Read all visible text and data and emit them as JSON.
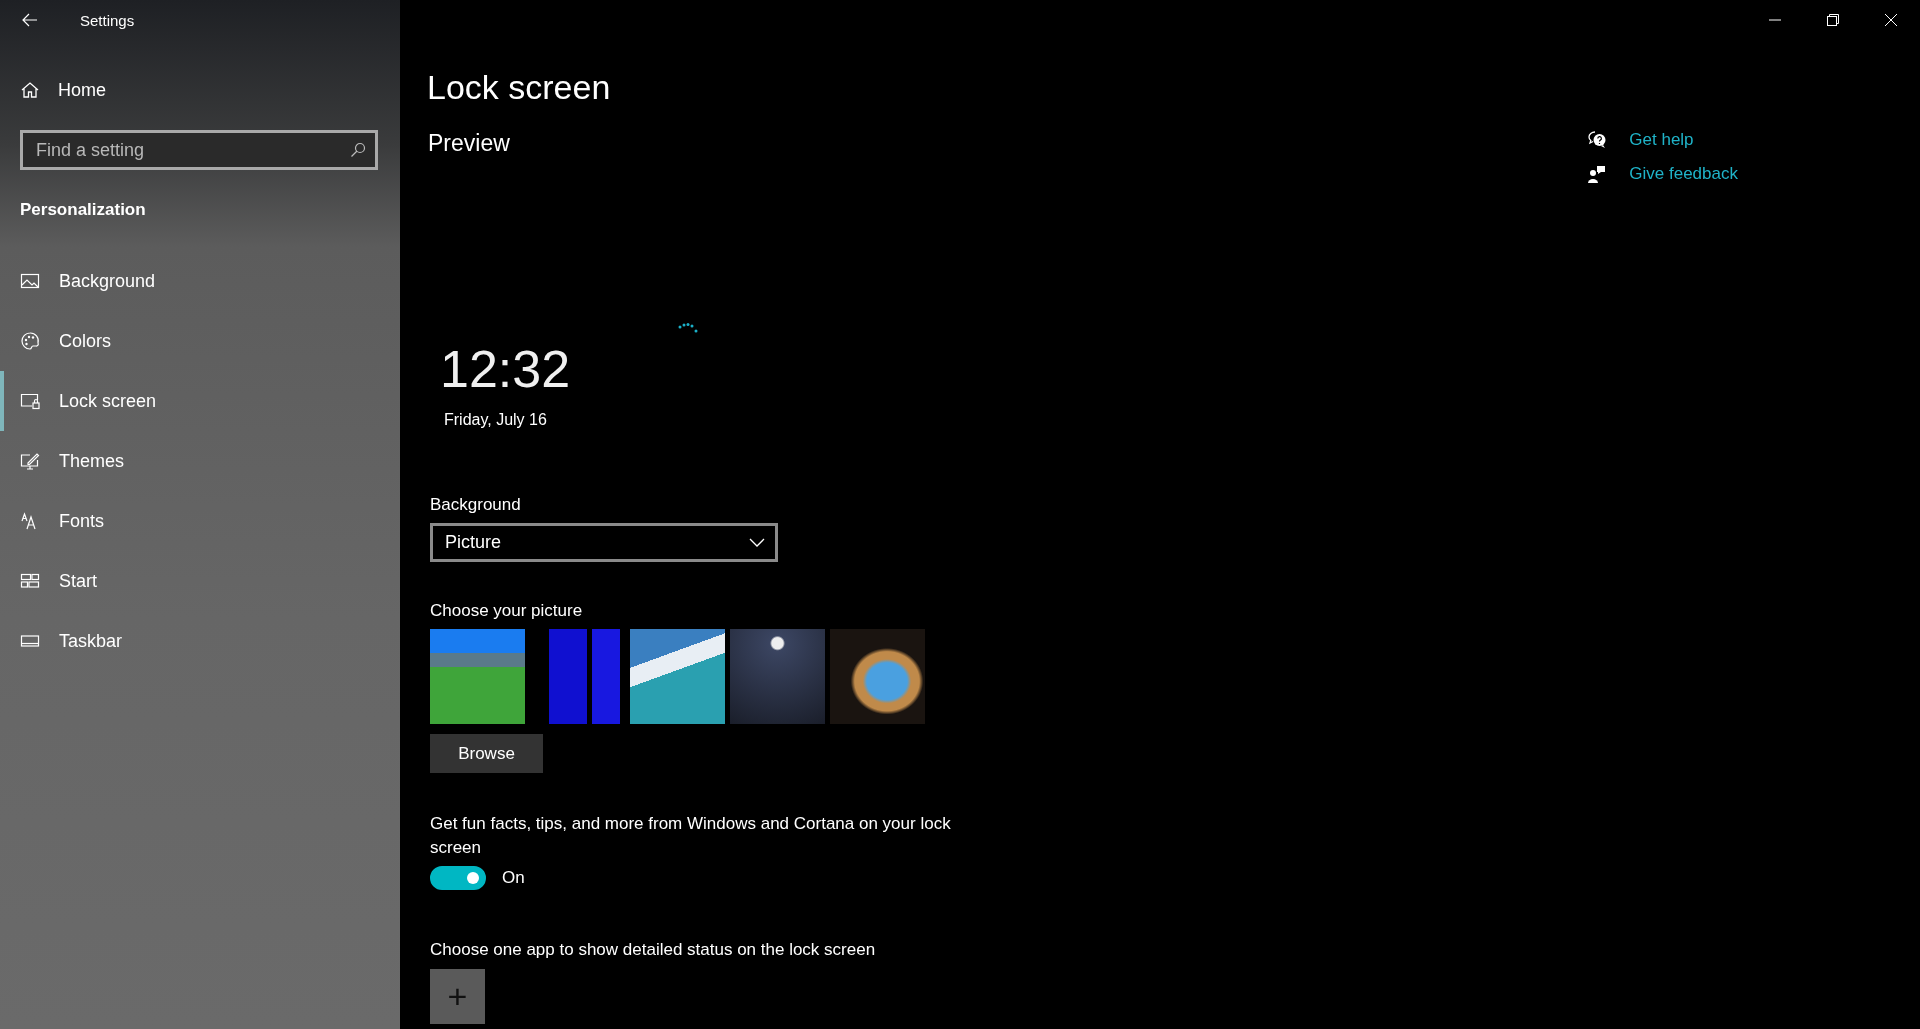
{
  "window": {
    "title": "Settings"
  },
  "sidebar": {
    "home": "Home",
    "search": {
      "placeholder": "Find a setting"
    },
    "section": "Personalization",
    "items": [
      {
        "label": "Background",
        "kind": "picture",
        "selected": false
      },
      {
        "label": "Colors",
        "kind": "palette",
        "selected": false
      },
      {
        "label": "Lock screen",
        "kind": "lock",
        "selected": true
      },
      {
        "label": "Themes",
        "kind": "themes",
        "selected": false
      },
      {
        "label": "Fonts",
        "kind": "fonts",
        "selected": false
      },
      {
        "label": "Start",
        "kind": "start",
        "selected": false
      },
      {
        "label": "Taskbar",
        "kind": "taskbar",
        "selected": false
      }
    ]
  },
  "page": {
    "title": "Lock screen",
    "preview": {
      "heading": "Preview",
      "time": "12:32",
      "date": "Friday, July 16"
    },
    "background": {
      "label": "Background",
      "value": "Picture"
    },
    "choose_picture": {
      "label": "Choose your picture",
      "button": "Browse"
    },
    "fun_facts": {
      "label": "Get fun facts, tips, and more from Windows and Cortana on your lock screen",
      "on": true,
      "state_text": "On"
    },
    "detailed_status": {
      "label": "Choose one app to show detailed status on the lock screen",
      "button": "+"
    }
  },
  "help_links": [
    {
      "kind": "help",
      "label": "Get help"
    },
    {
      "kind": "feedback",
      "label": "Give feedback"
    }
  ]
}
